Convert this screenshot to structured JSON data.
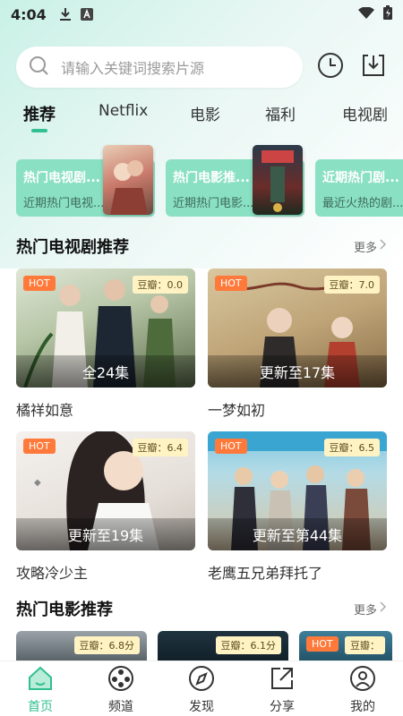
{
  "status_bar": {
    "time": "4:04"
  },
  "search": {
    "placeholder": "请输入关键词搜索片源"
  },
  "tabs": [
    {
      "label": "推荐",
      "active": true
    },
    {
      "label": "Netflix"
    },
    {
      "label": "电影"
    },
    {
      "label": "福利"
    },
    {
      "label": "电视剧"
    }
  ],
  "banners": [
    {
      "title": "热门电视剧...",
      "subtitle": "近期热门电视..."
    },
    {
      "title": "热门电影推...",
      "subtitle": "近期热门电影..."
    },
    {
      "title": "近期热门剧...",
      "subtitle": "最近火热的剧..."
    }
  ],
  "sections": {
    "tv": {
      "title": "热门电视剧推荐",
      "more": "更多"
    },
    "movie": {
      "title": "热门电影推荐",
      "more": "更多"
    }
  },
  "tv_cards": [
    {
      "title": "橘祥如意",
      "episodes": "全24集",
      "score": "豆瓣：0.0",
      "badge": "HOT"
    },
    {
      "title": "一梦如初",
      "episodes": "更新至17集",
      "score": "豆瓣：7.0",
      "badge": "HOT"
    },
    {
      "title": "攻略冷少主",
      "episodes": "更新至19集",
      "score": "豆瓣：6.4",
      "badge": "HOT"
    },
    {
      "title": "老鹰五兄弟拜托了",
      "episodes": "更新至第44集",
      "score": "豆瓣：6.5",
      "badge": "HOT"
    }
  ],
  "movie_cards": [
    {
      "score": "豆瓣：6.8分"
    },
    {
      "score": "豆瓣：6.1分"
    },
    {
      "score": "豆瓣：",
      "badge": "HOT"
    }
  ],
  "bottom_nav": [
    {
      "label": "首页",
      "active": true
    },
    {
      "label": "频道"
    },
    {
      "label": "发现"
    },
    {
      "label": "分享"
    },
    {
      "label": "我的"
    }
  ],
  "colors": {
    "accent": "#31c08f",
    "banner_bg": "#8ae0c2",
    "hot_badge": "#ff7a3a",
    "score_badge": "#fff3c4"
  }
}
